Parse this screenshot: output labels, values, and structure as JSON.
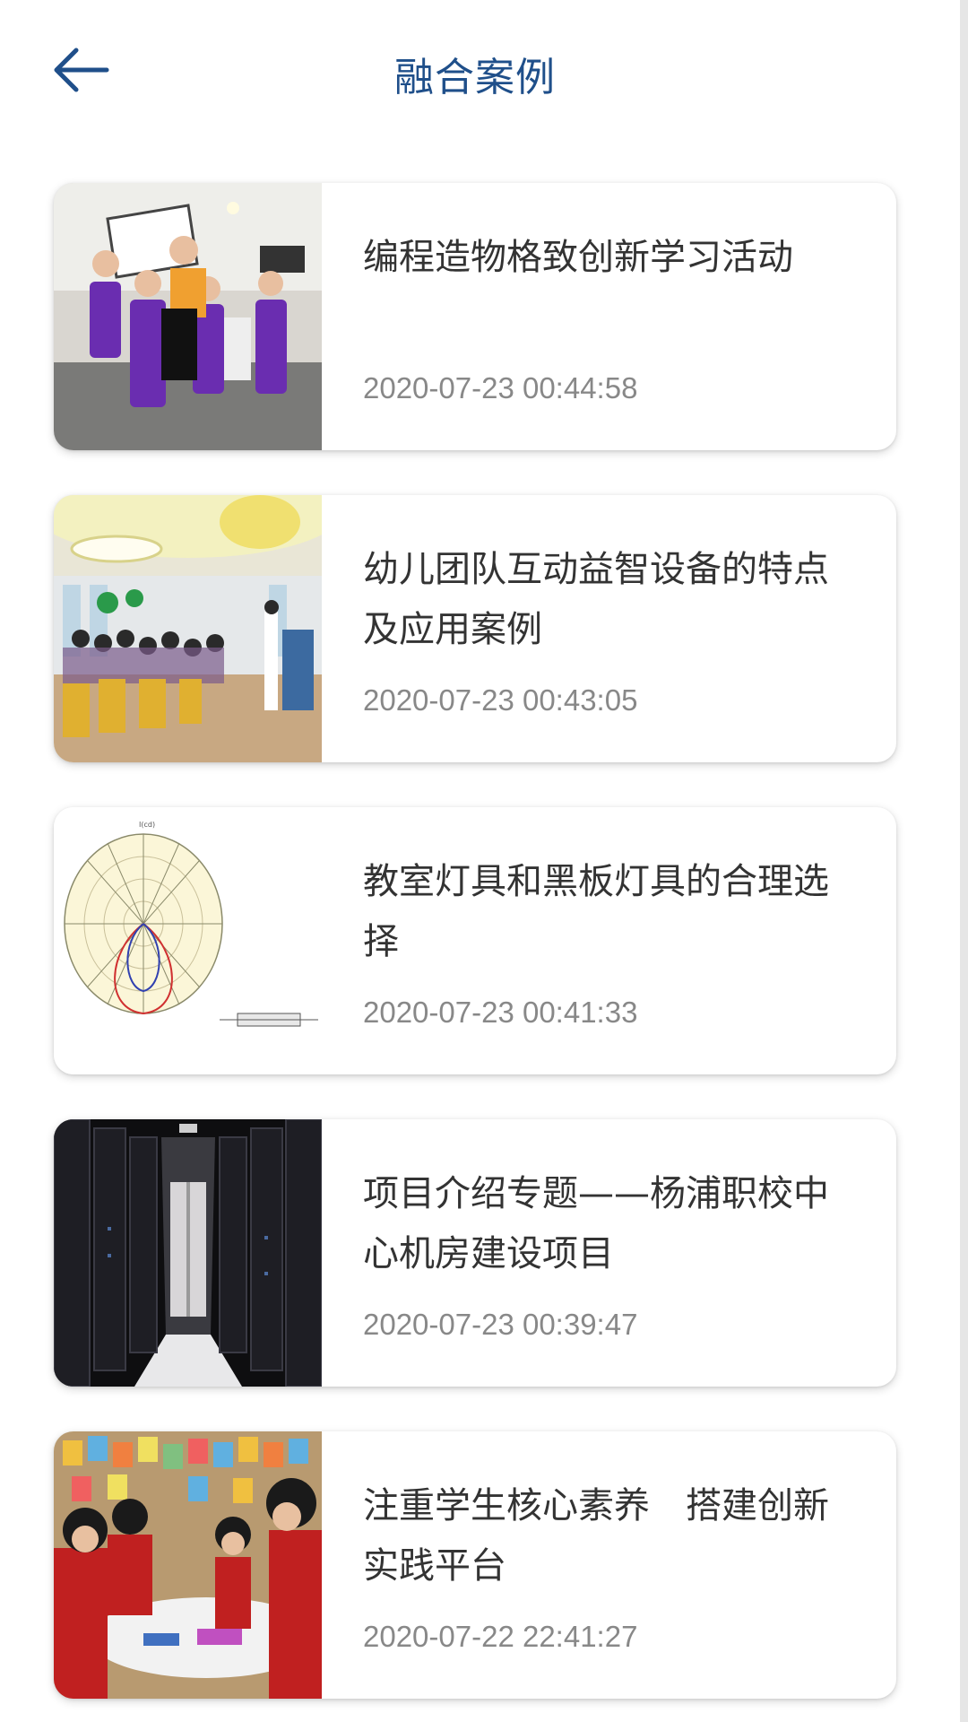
{
  "header": {
    "title": "融合案例",
    "back_icon": "arrow-left-icon",
    "accent_color": "#1f4f8a"
  },
  "cases": [
    {
      "title": "编程造物格致创新学习活动",
      "date": "2020-07-23 00:44:58",
      "thumbnail": "kids-purple-aprons-photo"
    },
    {
      "title": "幼儿团队互动益智设备的特点及应用案例",
      "date": "2020-07-23 00:43:05",
      "thumbnail": "classroom-audience-photo"
    },
    {
      "title": "教室灯具和黑板灯具的合理选择",
      "date": "2020-07-23 00:41:33",
      "thumbnail": "polar-light-distribution-diagram"
    },
    {
      "title": "项目介绍专题——杨浦职校中心机房建设项目",
      "date": "2020-07-23 00:39:47",
      "thumbnail": "server-room-photo"
    },
    {
      "title": "注重学生核心素养　搭建创新实践平台",
      "date": "2020-07-22 22:41:27",
      "thumbnail": "students-at-table-photo"
    }
  ]
}
